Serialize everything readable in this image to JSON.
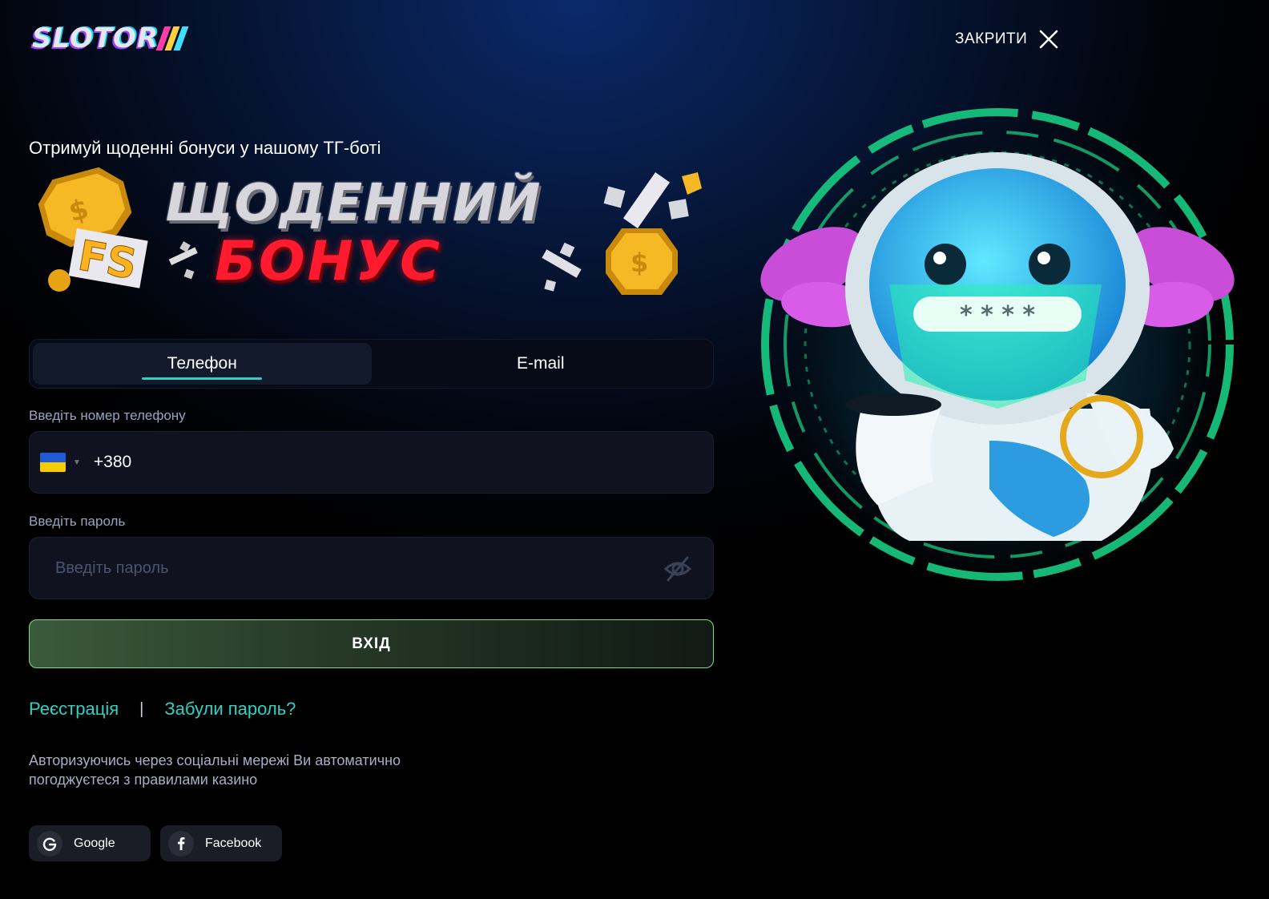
{
  "header": {
    "logo_text": "SLOTOR",
    "close_label": "ЗАКРИТИ"
  },
  "promo": {
    "title": "Отримуй щоденні бонуси у нашому ТГ-боті",
    "banner_line1": "ЩОДЕННИЙ",
    "banner_line2": "БОНУС",
    "banner_badge": "FS"
  },
  "tabs": [
    {
      "label": "Телефон",
      "active": true
    },
    {
      "label": "E-mail",
      "active": false
    }
  ],
  "phone": {
    "label": "Введіть номер телефону",
    "country_code": "+380",
    "flag_colors": [
      "#1f5bd6",
      "#f5cc00"
    ]
  },
  "password": {
    "label": "Введіть пароль",
    "placeholder": "Введіть пароль"
  },
  "login_button": "ВХІД",
  "links": {
    "register": "Реєстрація",
    "separator": "|",
    "forgot": "Забули пароль?"
  },
  "disclaimer": "Авторизуючись через соціальні мережі Ви автоматично погоджуєтеся з правилами казино",
  "social": [
    {
      "label": "Google",
      "icon": "google-icon"
    },
    {
      "label": "Facebook",
      "icon": "facebook-icon"
    }
  ],
  "hero": {
    "screen_text": "* * * *"
  },
  "colors": {
    "accent": "#2fd1c5",
    "login_border": "#7fdc8c",
    "banner_red": "#ff1a2e",
    "hero_ring": "#19d88a"
  }
}
